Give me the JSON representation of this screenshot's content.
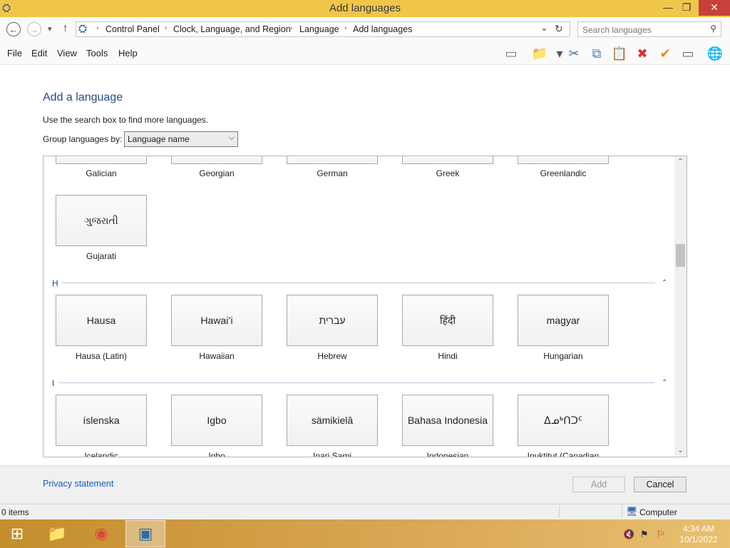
{
  "window": {
    "title": "Add languages",
    "controls": {
      "minimize": "—",
      "restore": "❐",
      "close": "✕"
    }
  },
  "nav": {
    "back": "←",
    "forward": "→",
    "recent": "▾",
    "up": "↑",
    "breadcrumbs": [
      "Control Panel",
      "Clock, Language, and Region",
      "Language",
      "Add languages"
    ],
    "dropdown": "⌄",
    "refresh": "↻"
  },
  "search": {
    "placeholder": "Search languages",
    "value": ""
  },
  "menu": [
    "File",
    "Edit",
    "View",
    "Tools",
    "Help"
  ],
  "toolbar_icons": [
    {
      "name": "layout-pane-icon",
      "glyph": "▭",
      "color": "#777777"
    },
    {
      "name": "folder-properties-icon",
      "glyph": "📁",
      "color": "#d9a640"
    },
    {
      "name": "dropdown-arrow-icon",
      "glyph": "▾",
      "color": "#555555"
    },
    {
      "name": "cut-icon",
      "glyph": "✂",
      "color": "#3a6ea8"
    },
    {
      "name": "copy-icon",
      "glyph": "⧉",
      "color": "#5a7fb0"
    },
    {
      "name": "paste-icon",
      "glyph": "📋",
      "color": "#a07a3a"
    },
    {
      "name": "delete-icon",
      "glyph": "✖",
      "color": "#d9312b"
    },
    {
      "name": "check-icon",
      "glyph": "✔",
      "color": "#e08a1e"
    },
    {
      "name": "properties-icon",
      "glyph": "▭",
      "color": "#666666"
    },
    {
      "name": "globe-icon",
      "glyph": "🌐",
      "color": "#2a7fbf"
    }
  ],
  "page": {
    "heading": "Add a language",
    "hint": "Use the search box to find more languages.",
    "group_by_label": "Group languages by:",
    "group_by_value": "Language name"
  },
  "languages": {
    "cut_row": [
      {
        "name": "Galician"
      },
      {
        "name": "Georgian"
      },
      {
        "name": "German"
      },
      {
        "name": "Greek"
      },
      {
        "name": "Greenlandic"
      }
    ],
    "g_row": [
      {
        "native": "ગુજરાતી",
        "name": "Gujarati"
      }
    ],
    "group_h": "H",
    "h_row": [
      {
        "native": "Hausa",
        "name": "Hausa (Latin)"
      },
      {
        "native": "Hawaiʻi",
        "name": "Hawaiian"
      },
      {
        "native": "עברית",
        "name": "Hebrew"
      },
      {
        "native": "हिंदी",
        "name": "Hindi"
      },
      {
        "native": "magyar",
        "name": "Hungarian"
      }
    ],
    "group_i": "I",
    "i_row": [
      {
        "native": "íslenska",
        "name": "Icelandic"
      },
      {
        "native": "Igbo",
        "name": "Igbo"
      },
      {
        "native": "sämikielâ",
        "name": "Inari Sami"
      },
      {
        "native": "Bahasa Indonesia",
        "name": "Indonesian"
      },
      {
        "native": "ᐃᓄᒃᑎᑐᑦ",
        "name": "Inuktitut (Canadian"
      }
    ],
    "collapse_glyph": "⌃"
  },
  "footer": {
    "privacy": "Privacy statement",
    "add": "Add",
    "cancel": "Cancel"
  },
  "status": {
    "items": "0 items",
    "location": "Computer"
  },
  "taskbar": {
    "time": "4:34 AM",
    "date": "10/1/2022"
  }
}
